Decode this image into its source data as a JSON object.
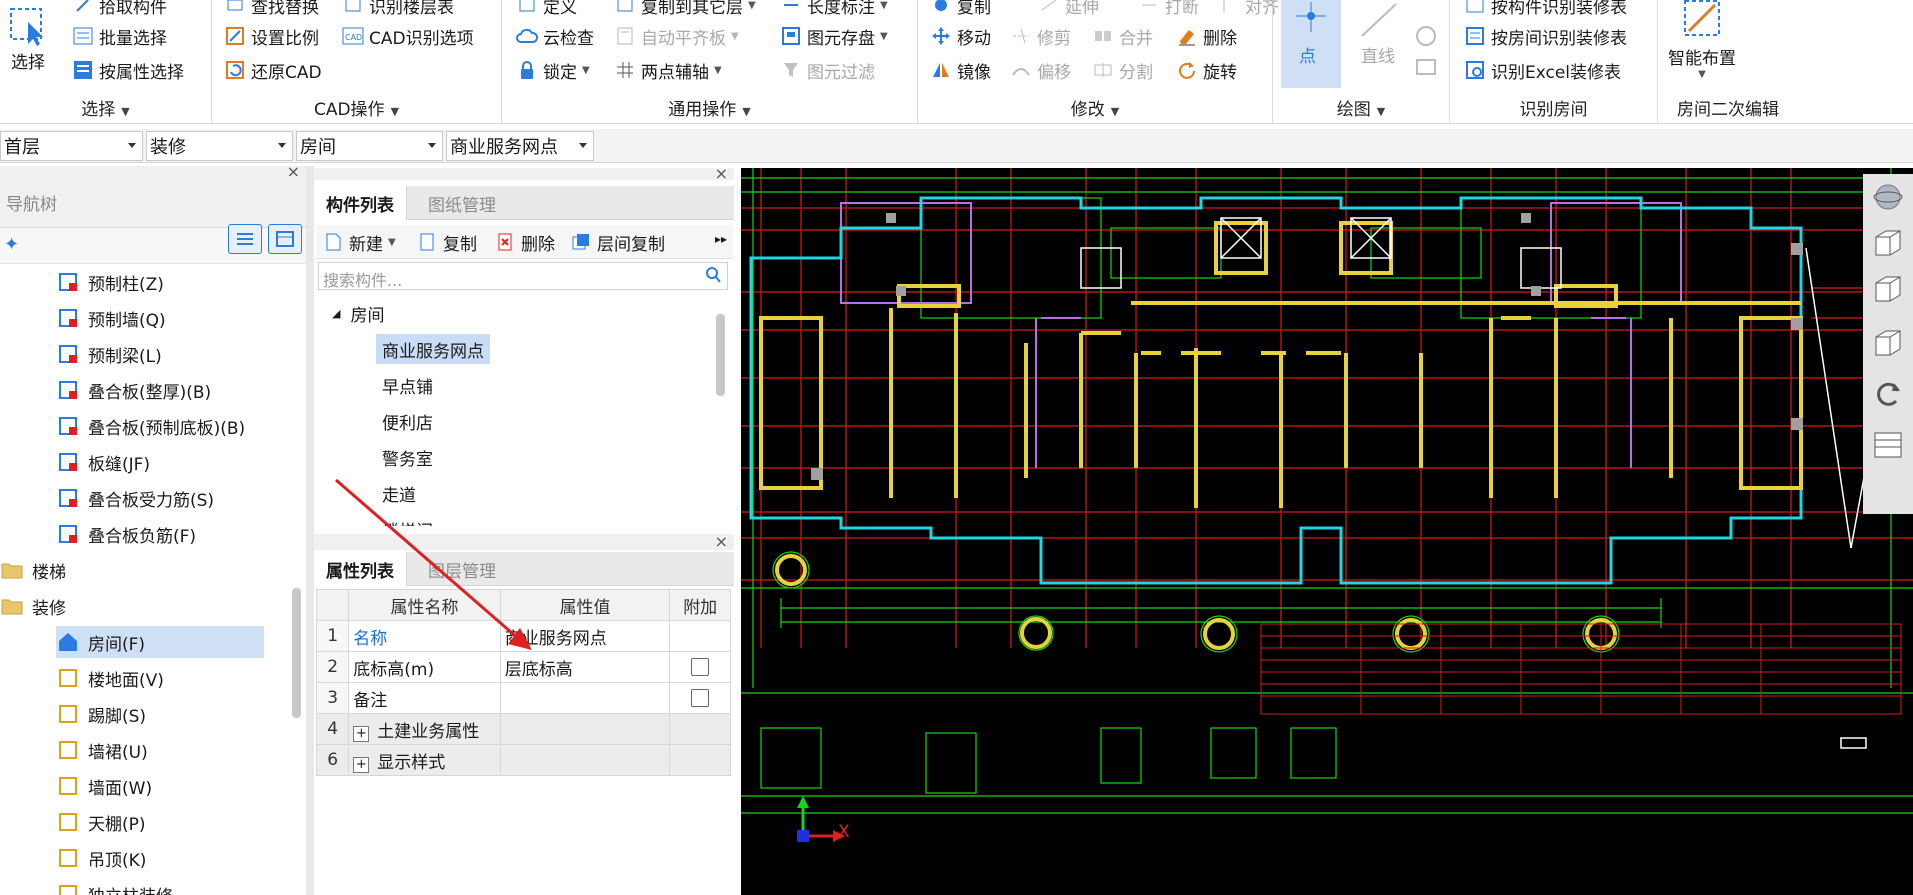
{
  "ribbon": {
    "select": {
      "big_label": "选择",
      "items": [
        "拾取构件",
        "批量选择",
        "按属性选择"
      ],
      "group_label": "选择"
    },
    "cad": {
      "items": [
        "查找替换",
        "识别楼层表",
        "设置比例",
        "CAD识别选项",
        "还原CAD"
      ],
      "group_label": "CAD操作"
    },
    "common": {
      "items": [
        "定义",
        "复制到其它层",
        "长度标注",
        "云检查",
        "自动平齐板",
        "图元存盘",
        "锁定",
        "两点辅轴",
        "图元过滤"
      ],
      "group_label": "通用操作"
    },
    "modify": {
      "items": [
        "复制",
        "延伸",
        "打断",
        "对齐",
        "移动",
        "修剪",
        "合并",
        "删除",
        "镜像",
        "偏移",
        "分割",
        "旋转"
      ],
      "group_label": "修改"
    },
    "draw": {
      "items": [
        "点",
        "直线"
      ],
      "group_label": "绘图"
    },
    "identify": {
      "items": [
        "按构件识别装修表",
        "按房间识别装修表",
        "识别Excel装修表"
      ],
      "group_label": "识别房间"
    },
    "edit2": {
      "big_label": "智能布置",
      "group_label": "房间二次编辑"
    }
  },
  "combos": [
    "首层",
    "装修",
    "房间",
    "商业服务网点"
  ],
  "nav": {
    "title": "导航树",
    "items": [
      {
        "label": "预制柱(Z)",
        "icon": "precast-column-icon"
      },
      {
        "label": "预制墙(Q)",
        "icon": "precast-wall-icon"
      },
      {
        "label": "预制梁(L)",
        "icon": "precast-beam-icon"
      },
      {
        "label": "叠合板(整厚)(B)",
        "icon": "composite-slab-icon"
      },
      {
        "label": "叠合板(预制底板)(B)",
        "icon": "composite-slab-bottom-icon"
      },
      {
        "label": "板缝(JF)",
        "icon": "slab-joint-icon"
      },
      {
        "label": "叠合板受力筋(S)",
        "icon": "slab-rebar-icon"
      },
      {
        "label": "叠合板负筋(F)",
        "icon": "slab-neg-rebar-icon"
      },
      {
        "label": "楼梯",
        "icon": "folder-icon"
      },
      {
        "label": "装修",
        "icon": "folder-open-icon"
      },
      {
        "label": "房间(F)",
        "icon": "room-icon"
      },
      {
        "label": "楼地面(V)",
        "icon": "floor-icon"
      },
      {
        "label": "踢脚(S)",
        "icon": "skirting-icon"
      },
      {
        "label": "墙裙(U)",
        "icon": "dado-icon"
      },
      {
        "label": "墙面(W)",
        "icon": "wall-surface-icon"
      },
      {
        "label": "天棚(P)",
        "icon": "ceiling-icon"
      },
      {
        "label": "吊顶(K)",
        "icon": "suspended-ceiling-icon"
      },
      {
        "label": "独立柱装修",
        "icon": "column-finish-icon"
      }
    ]
  },
  "component_panel": {
    "tabs": [
      "构件列表",
      "图纸管理"
    ],
    "toolbar": [
      "新建",
      "复制",
      "删除",
      "层间复制"
    ],
    "search_placeholder": "搜索构件...",
    "tree_root": "房间",
    "tree_items": [
      "商业服务网点",
      "早点铺",
      "便利店",
      "警务室",
      "走道",
      "楼梯间"
    ]
  },
  "property_panel": {
    "tabs": [
      "属性列表",
      "图层管理"
    ],
    "columns": [
      "属性名称",
      "属性值",
      "附加"
    ],
    "rows": [
      {
        "num": "1",
        "name": "名称",
        "value": "商业服务网点"
      },
      {
        "num": "2",
        "name": "底标高(m)",
        "value": "层底标高"
      },
      {
        "num": "3",
        "name": "备注",
        "value": ""
      },
      {
        "num": "4",
        "name": "土建业务属性",
        "value": ""
      },
      {
        "num": "6",
        "name": "显示样式",
        "value": ""
      }
    ]
  },
  "viewport": {
    "axis_x_label": "X"
  },
  "colors": {
    "accent_blue": "#2b7be0",
    "selection": "#cfe0f6",
    "cad_background": "#000000",
    "annotation_red": "#e02020"
  }
}
